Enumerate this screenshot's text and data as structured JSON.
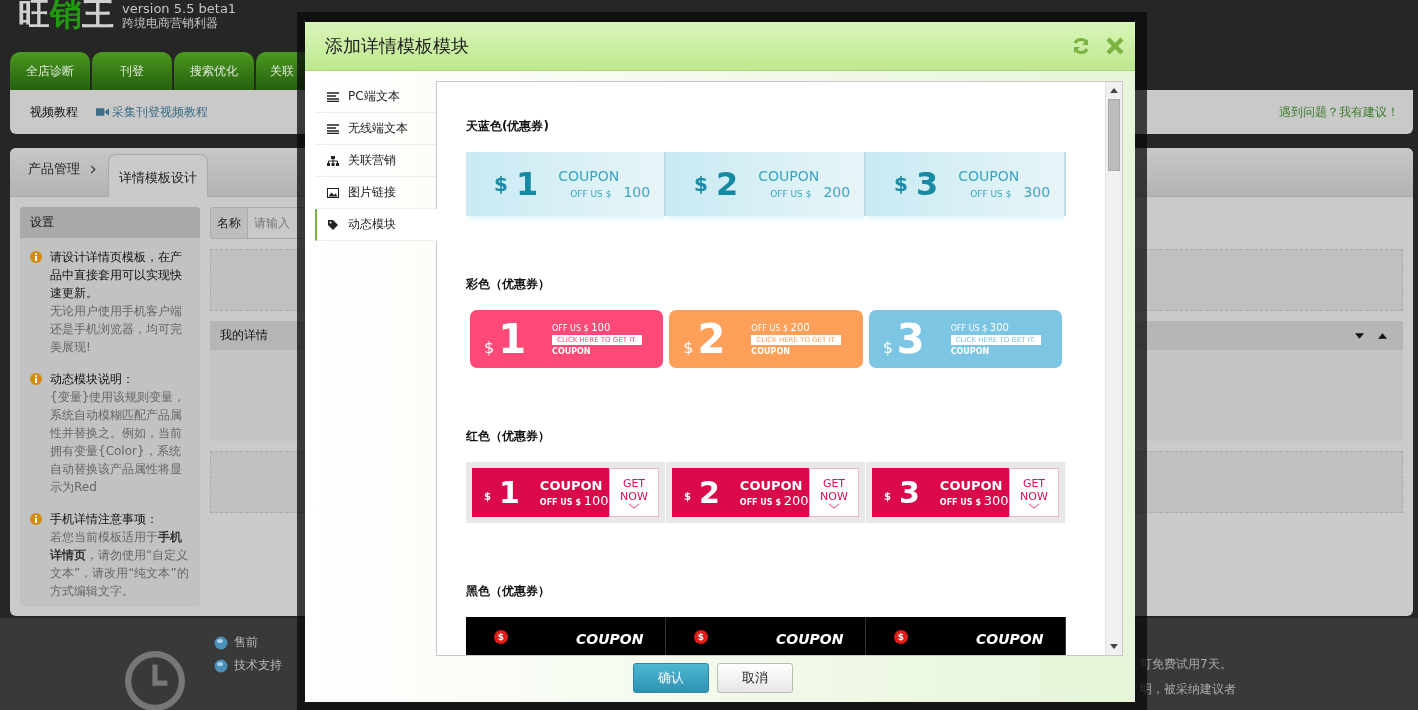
{
  "app": {
    "logo": [
      {
        "text": "旺",
        "highlight": false
      },
      {
        "text": "销",
        "highlight": true
      },
      {
        "text": "王",
        "highlight": false
      }
    ],
    "version": "version 5.5 beta1",
    "tagline": "跨境电商营销利器"
  },
  "nav_tabs": [
    {
      "label": "全店诊断"
    },
    {
      "label": "刊登"
    },
    {
      "label": "搜索优化"
    },
    {
      "label": "关联"
    }
  ],
  "sub_bar": {
    "label": "视频教程",
    "link": "采集刊登视频教程",
    "feedback": "遇到问题？我有建议！"
  },
  "breadcrumb": [
    {
      "label": "产品管理",
      "selected": false
    },
    {
      "label": "详情模板设计",
      "selected": true
    }
  ],
  "settings": {
    "title": "设置",
    "notes": [
      {
        "heading": "请设计详情页模板，在产品中直接套用可以实现快速更新。",
        "body": "无论用户使用手机客户端还是手机浏览器，均可完美展现!"
      },
      {
        "heading": "动态模块说明：",
        "body": "{变量}使用该规则变量，系统自动模糊匹配产品属性并替换之。例如，当前拥有变量{Color}，系统自动替换该产品属性将显示为Red"
      },
      {
        "heading": "手机详情注意事项：",
        "body": "若您当前模板适用于**手机详情页**，请勿使用“自定义文本”，请改用“纯文本”的方式编辑文字。"
      }
    ]
  },
  "name_field": {
    "label": "名称",
    "placeholder": "请输入"
  },
  "my_details": {
    "title": "我的详情"
  },
  "footer": {
    "links": [
      {
        "label": "售前"
      },
      {
        "label": "技术支持"
      }
    ],
    "notes": [
      "可免费试用7天。",
      "明，被采纳建议者"
    ]
  },
  "modal": {
    "title": "添加详情模板模块",
    "menu": [
      {
        "label": "PC端文本",
        "kind": "lines",
        "selected": false
      },
      {
        "label": "无线端文本",
        "kind": "lines",
        "selected": false
      },
      {
        "label": "关联营销",
        "kind": "tree",
        "selected": false
      },
      {
        "label": "图片链接",
        "kind": "image",
        "selected": false
      },
      {
        "label": "动态模块",
        "kind": "tag",
        "selected": true
      }
    ],
    "sections": [
      {
        "title": "天蓝色(优惠券)",
        "kind": "sky",
        "coupons": [
          {
            "currency": "$",
            "number": "1",
            "label": "COUPON",
            "off_label": "OFF US $",
            "amount": "100"
          },
          {
            "currency": "$",
            "number": "2",
            "label": "COUPON",
            "off_label": "OFF US $",
            "amount": "200"
          },
          {
            "currency": "$",
            "number": "3",
            "label": "COUPON",
            "off_label": "OFF US $",
            "amount": "300"
          }
        ]
      },
      {
        "title": "彩色（优惠券）",
        "kind": "colorful",
        "coupons": [
          {
            "currency": "$",
            "number": "1",
            "off_label": "OFF US $",
            "amount": "100",
            "cta": "CLICK HERE TO GET IT.",
            "label": "COUPON",
            "color": "#ff4a78"
          },
          {
            "currency": "$",
            "number": "2",
            "off_label": "OFF US $",
            "amount": "200",
            "cta": "CLICK HERE TO GET IT.",
            "label": "COUPON",
            "color": "#ffa05a"
          },
          {
            "currency": "$",
            "number": "3",
            "off_label": "OFF US $",
            "amount": "300",
            "cta": "CLICK HERE TO GET IT.",
            "label": "COUPON",
            "color": "#7cc6e4"
          }
        ]
      },
      {
        "title": "红色（优惠券）",
        "kind": "red",
        "coupons": [
          {
            "currency": "$",
            "number": "1",
            "label": "COUPON",
            "off_label": "OFF US $",
            "amount": "100",
            "cta": "GET NOW"
          },
          {
            "currency": "$",
            "number": "2",
            "label": "COUPON",
            "off_label": "OFF US $",
            "amount": "200",
            "cta": "GET NOW"
          },
          {
            "currency": "$",
            "number": "3",
            "label": "COUPON",
            "off_label": "OFF US $",
            "amount": "300",
            "cta": "GET NOW"
          }
        ]
      },
      {
        "title": "黑色（优惠券）",
        "kind": "black",
        "coupons": [
          {
            "currency": "$",
            "label": "COUPON"
          },
          {
            "currency": "$",
            "label": "COUPON"
          },
          {
            "currency": "$",
            "label": "COUPON"
          }
        ]
      }
    ],
    "buttons": [
      {
        "label": "确认",
        "kind": "primary"
      },
      {
        "label": "取消",
        "kind": "secondary"
      }
    ]
  }
}
